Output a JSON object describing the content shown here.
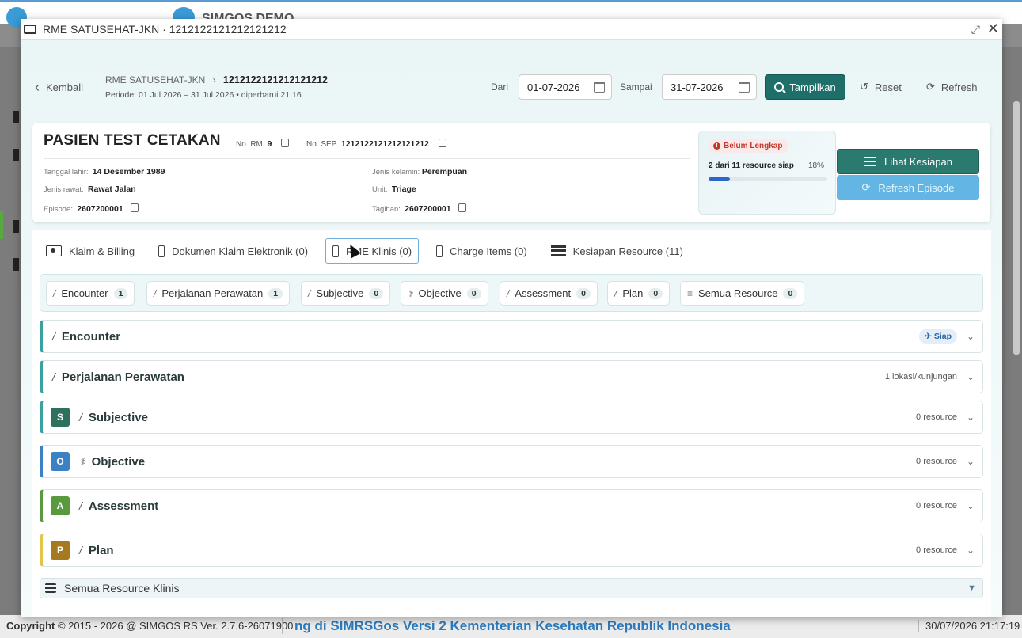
{
  "background": {
    "app_name": "SIMGOS DEMO",
    "footer_copyright": "Copyright",
    "footer_text": " 2015 - 2026 @ SIMGOS RS Ver. 2.7.6-26071900",
    "footer_marquee": "ng di SIMRSGos Versi 2 Kementerian Kesehatan Republik Indonesia",
    "footer_clock": "30/07/2026 21:17:19"
  },
  "modal": {
    "title": "RME SATUSEHAT-JKN · 1212122121212121212"
  },
  "header": {
    "back_label": "Kembali",
    "crumb_root": "RME SATUSEHAT-JKN",
    "crumb_current": "1212122121212121212",
    "period": "Periode: 01 Jul 2026 – 31 Jul 2026 • diperbarui 21:16",
    "from_label": "Dari",
    "from_value": "01-07-2026",
    "to_label": "Sampai",
    "to_value": "31-07-2026",
    "show_label": "Tampilkan",
    "reset_label": "Reset",
    "refresh_label": "Refresh"
  },
  "patient": {
    "name": "PASIEN TEST CETAKAN",
    "rm_label": "No. RM",
    "rm_value": "9",
    "sep_label": "No. SEP",
    "sep_value": "1212122121212121212",
    "dob_label": "Tanggal lahir:",
    "dob_value": "14 Desember 1989",
    "sex_label": "Jenis kelamin:",
    "sex_value": "Perempuan",
    "care_label": "Jenis rawat:",
    "care_value": "Rawat Jalan",
    "unit_label": "Unit:",
    "unit_value": "Triage",
    "episode_label": "Episode:",
    "episode_value": "2607200001",
    "bill_label": "Tagihan:",
    "bill_value": "2607200001"
  },
  "readiness": {
    "status": "Belum Lengkap",
    "summary": "2 dari 11 resource siap",
    "percent_text": "18%",
    "percent": 18,
    "view_label": "Lihat Kesiapan",
    "refresh_label": "Refresh Episode"
  },
  "tabs": [
    {
      "label": "Klaim & Billing"
    },
    {
      "label": "Dokumen Klaim Elektronik (0)"
    },
    {
      "label": "RME Klinis (0)"
    },
    {
      "label": "Charge Items (0)"
    },
    {
      "label": "Kesiapan Resource (11)"
    }
  ],
  "chips": [
    {
      "label": "Encounter",
      "count": "1"
    },
    {
      "label": "Perjalanan Perawatan",
      "count": "1"
    },
    {
      "label": "Subjective",
      "count": "0"
    },
    {
      "label": "Objective",
      "count": "0"
    },
    {
      "label": "Assessment",
      "count": "0"
    },
    {
      "label": "Plan",
      "count": "0"
    },
    {
      "label": "Semua Resource",
      "count": "0"
    }
  ],
  "sections": [
    {
      "title": "Encounter",
      "status": "Siap"
    },
    {
      "title": "Perjalanan Perawatan",
      "right": "1 lokasi/kunjungan"
    },
    {
      "title": "Subjective",
      "letter": "S",
      "right": "0 resource",
      "color": "#2f6f5e"
    },
    {
      "title": "Objective",
      "letter": "O",
      "right": "0 resource",
      "color": "#3b82c4"
    },
    {
      "title": "Assessment",
      "letter": "A",
      "right": "0 resource",
      "color": "#5a9a3f"
    },
    {
      "title": "Plan",
      "letter": "P",
      "right": "0 resource",
      "color": "#a57a1f"
    }
  ],
  "all_resources": "Semua Resource Klinis"
}
